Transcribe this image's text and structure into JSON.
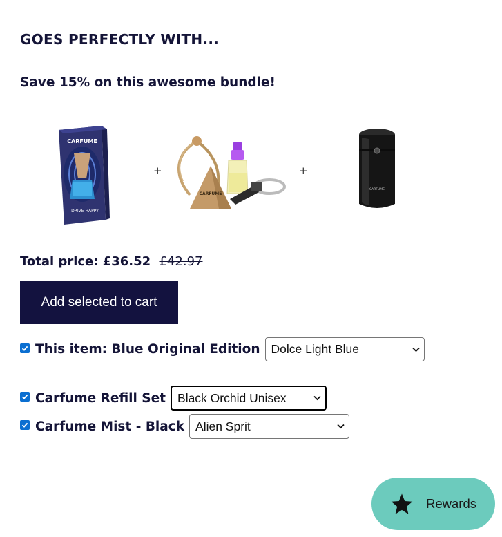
{
  "section": {
    "heading": "GOES PERFECTLY WITH...",
    "subheading": "Save 15% on this awesome bundle!"
  },
  "products": [
    {
      "icon": "carfume-box-image",
      "box_brand": "CARFUME",
      "box_tagline": "DRIVE HAPPY"
    },
    {
      "icon": "refill-set-image",
      "tag_text": "CARFUME"
    },
    {
      "icon": "mist-bottle-image",
      "label_text": "CARFUME"
    }
  ],
  "separator": "+",
  "pricing": {
    "label": "Total price:",
    "total": "£36.52",
    "original": "£42.97"
  },
  "cart_button": {
    "label": "Add selected to cart"
  },
  "items": [
    {
      "label": "This item: Blue Original Edition",
      "checked": true,
      "option": "Dolce Light Blue"
    },
    {
      "label": "Carfume Refill Set",
      "checked": true,
      "option": "Black Orchid Unisex"
    },
    {
      "label": "Carfume Mist - Black",
      "checked": true,
      "option": "Alien Sprit"
    }
  ],
  "rewards": {
    "label": "Rewards",
    "icon": "star-icon"
  },
  "colors": {
    "text": "#141437",
    "button": "#13123f",
    "rewards_bg": "#6ccbbd",
    "checkbox": "#0b6fd1"
  }
}
